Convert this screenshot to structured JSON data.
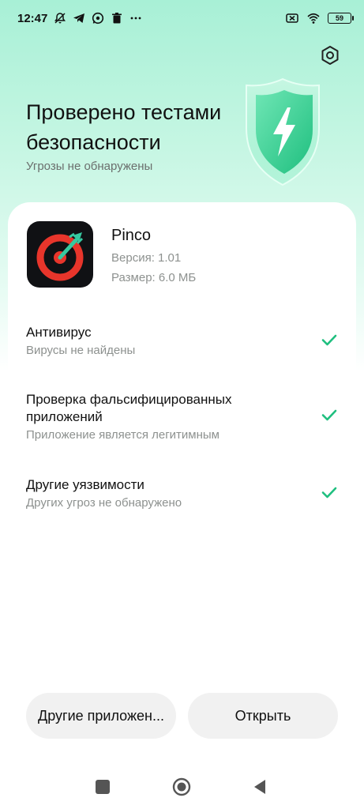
{
  "status_bar": {
    "time": "12:47",
    "battery": "59",
    "icons": [
      "bell-off-icon",
      "telegram-icon",
      "whatsapp-icon",
      "trash-icon",
      "more-icon",
      "sim-icon",
      "wifi-icon",
      "battery-icon"
    ]
  },
  "header": {
    "title": "Проверено тестами безопасности",
    "subtitle": "Угрозы не обнаружены",
    "settings_icon": "settings-icon",
    "shield_icon": "shield-lightning-icon"
  },
  "app": {
    "name": "Pinco",
    "version": "Версия: 1.01",
    "size": "Размер: 6.0 МБ"
  },
  "checks": [
    {
      "title": "Антивирус",
      "description": "Вирусы не найдены"
    },
    {
      "title": "Проверка фальсифицированных приложений",
      "description": "Приложение является легитимным"
    },
    {
      "title": "Другие уязвимости",
      "description": "Других угроз не обнаружено"
    }
  ],
  "buttons": {
    "other_apps": "Другие приложен...",
    "open": "Открыть"
  },
  "colors": {
    "accent": "#1fbf7f",
    "hero_top": "#a8f0d6",
    "button_bg": "#f1f1f1",
    "app_icon_red": "#e8352b"
  }
}
